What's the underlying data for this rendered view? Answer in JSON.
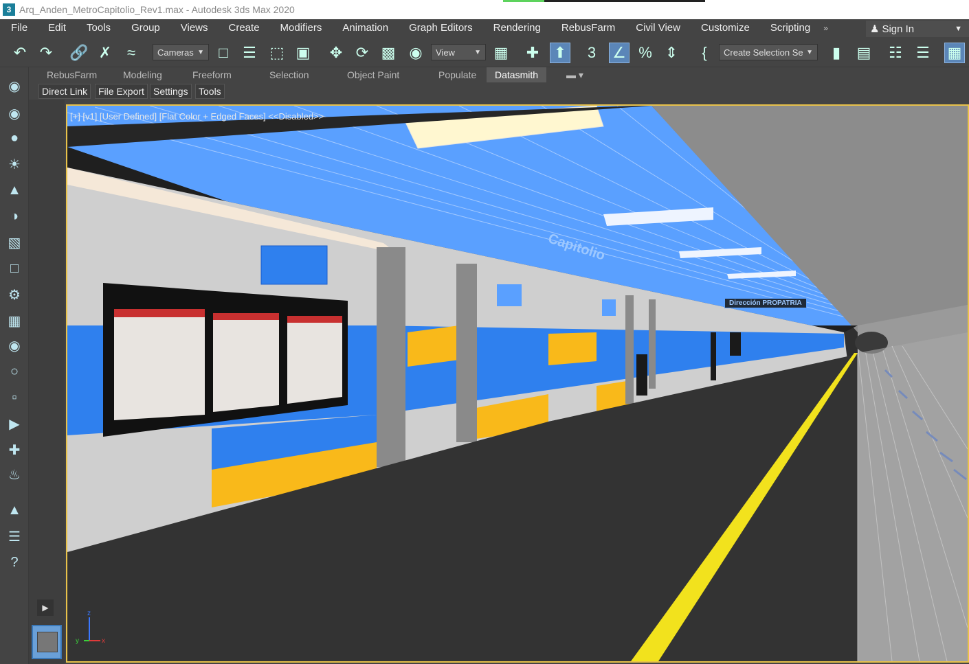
{
  "window": {
    "title": "Arq_Anden_MetroCapitolio_Rev1.max - Autodesk 3ds Max 2020",
    "app_icon": "3"
  },
  "menu": [
    "File",
    "Edit",
    "Tools",
    "Group",
    "Views",
    "Create",
    "Modifiers",
    "Animation",
    "Graph Editors",
    "Rendering",
    "RebusFarm",
    "Civil View",
    "Customize",
    "Scripting"
  ],
  "menu_more": "»",
  "sign_in": "Sign In",
  "toolbar": {
    "cameras_dropdown": "Cameras",
    "view_dropdown": "View",
    "selection_set_dropdown": "Create Selection Se"
  },
  "ribbon": {
    "tabs": [
      "RebusFarm",
      "Modeling",
      "Freeform",
      "Selection",
      "Object Paint",
      "Populate",
      "Datasmith"
    ],
    "active_tab": "Datasmith",
    "subtabs": [
      "Direct Link",
      "File Export",
      "Settings",
      "Tools"
    ]
  },
  "viewport": {
    "label": "[+] [v1] [User Defined] [Flat Color + Edged Faces]  <<Disabled>>",
    "station_name": "Capitolio",
    "direction_sign": "Dirección  PROPATRIA",
    "axis_labels": [
      "z",
      "y",
      "x"
    ]
  },
  "colors": {
    "accent_yellow": "#e8c24a",
    "wall_blue": "#2f80ee",
    "wall_yellow": "#f9b91a",
    "ceiling_blue": "#5aa0ff",
    "platform": "#333333",
    "safety_line": "#f2e21d"
  }
}
